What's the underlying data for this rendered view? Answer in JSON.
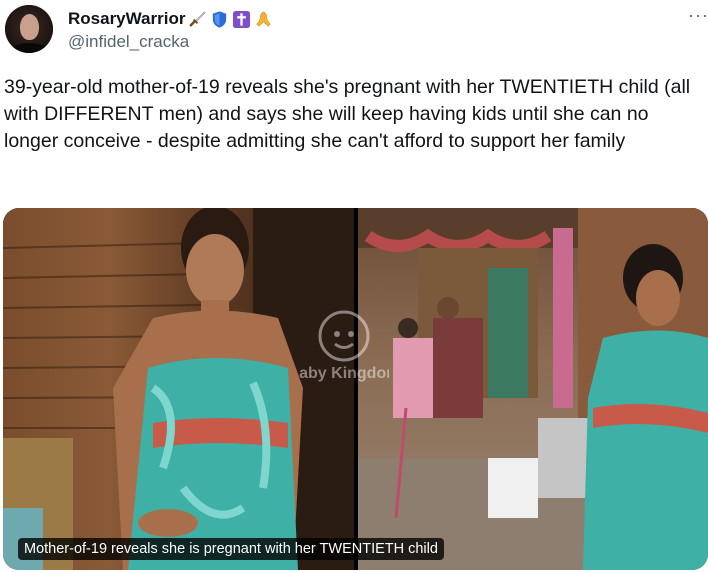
{
  "author": {
    "display_name": "RosaryWarrior",
    "handle": "@infidel_cracka",
    "emoji_icons": [
      "dagger-icon",
      "shield-icon",
      "latin-cross-icon",
      "praying-hands-icon"
    ]
  },
  "tweet": {
    "text": "39-year-old mother-of-19 reveals she's pregnant with her TWENTIETH child (all with DIFFERENT men) and says she will keep having kids until she can no longer conceive - despite admitting she can't afford to support her family"
  },
  "media": {
    "caption": "Mother-of-19 reveals she is pregnant with her TWENTIETH child",
    "watermark_text": "Baby Kingdom"
  },
  "colors": {
    "text": "#0f1419",
    "secondary": "#536471",
    "shield_blue": "#2b6cd6",
    "cross_purple": "#7f4fc9",
    "hands_yellow": "#f5b92e"
  }
}
